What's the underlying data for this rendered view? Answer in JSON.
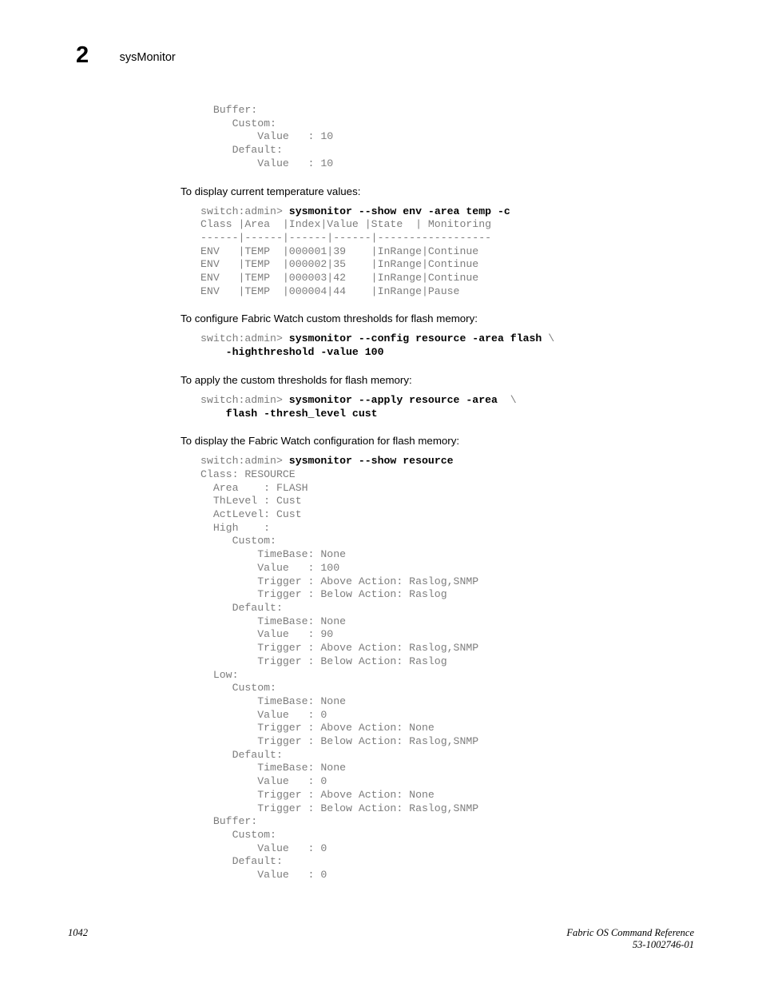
{
  "header": {
    "chapter_number": "2",
    "title": "sysMonitor"
  },
  "footer": {
    "page_number": "1042",
    "doc_title": "Fabric OS Command Reference",
    "doc_number": "53-1002746-01"
  },
  "sections": {
    "buffer_top_code": "  Buffer:\n     Custom:\n         Value   : 10\n     Default:\n         Value   : 10",
    "temp_heading": "To display current temperature values:",
    "temp_prompt": "switch:admin> ",
    "temp_command": "sysmonitor --show env -area temp -c",
    "temp_output": "Class |Area  |Index|Value |State  | Monitoring\n------|------|------|------|------------------\nENV   |TEMP  |000001|39    |InRange|Continue\nENV   |TEMP  |000002|35    |InRange|Continue\nENV   |TEMP  |000003|42    |InRange|Continue\nENV   |TEMP  |000004|44    |InRange|Pause",
    "config_heading": "To configure Fabric Watch custom thresholds for flash memory:",
    "config_prompt": "switch:admin> ",
    "config_command": "sysmonitor --config resource -area flash",
    "config_continuation_marker": " \\",
    "config_command_line2": "    -highthreshold -value 100",
    "apply_heading": "To apply the custom thresholds for flash memory:",
    "apply_prompt": "switch:admin> ",
    "apply_command": "sysmonitor --apply resource -area",
    "apply_continuation_marker": "  \\",
    "apply_command_line2": "    flash -thresh_level cust",
    "show_heading": "To display the Fabric Watch configuration for flash memory:",
    "show_prompt": "switch:admin> ",
    "show_command": "sysmonitor --show resource",
    "show_output": "Class: RESOURCE\n  Area    : FLASH\n  ThLevel : Cust\n  ActLevel: Cust\n  High    :\n     Custom:\n         TimeBase: None\n         Value   : 100\n         Trigger : Above Action: Raslog,SNMP\n         Trigger : Below Action: Raslog\n     Default:\n         TimeBase: None\n         Value   : 90\n         Trigger : Above Action: Raslog,SNMP\n         Trigger : Below Action: Raslog\n  Low:\n     Custom:\n         TimeBase: None\n         Value   : 0\n         Trigger : Above Action: None\n         Trigger : Below Action: Raslog,SNMP\n     Default:\n         TimeBase: None\n         Value   : 0\n         Trigger : Above Action: None\n         Trigger : Below Action: Raslog,SNMP\n  Buffer:\n     Custom:\n         Value   : 0\n     Default:\n         Value   : 0"
  }
}
